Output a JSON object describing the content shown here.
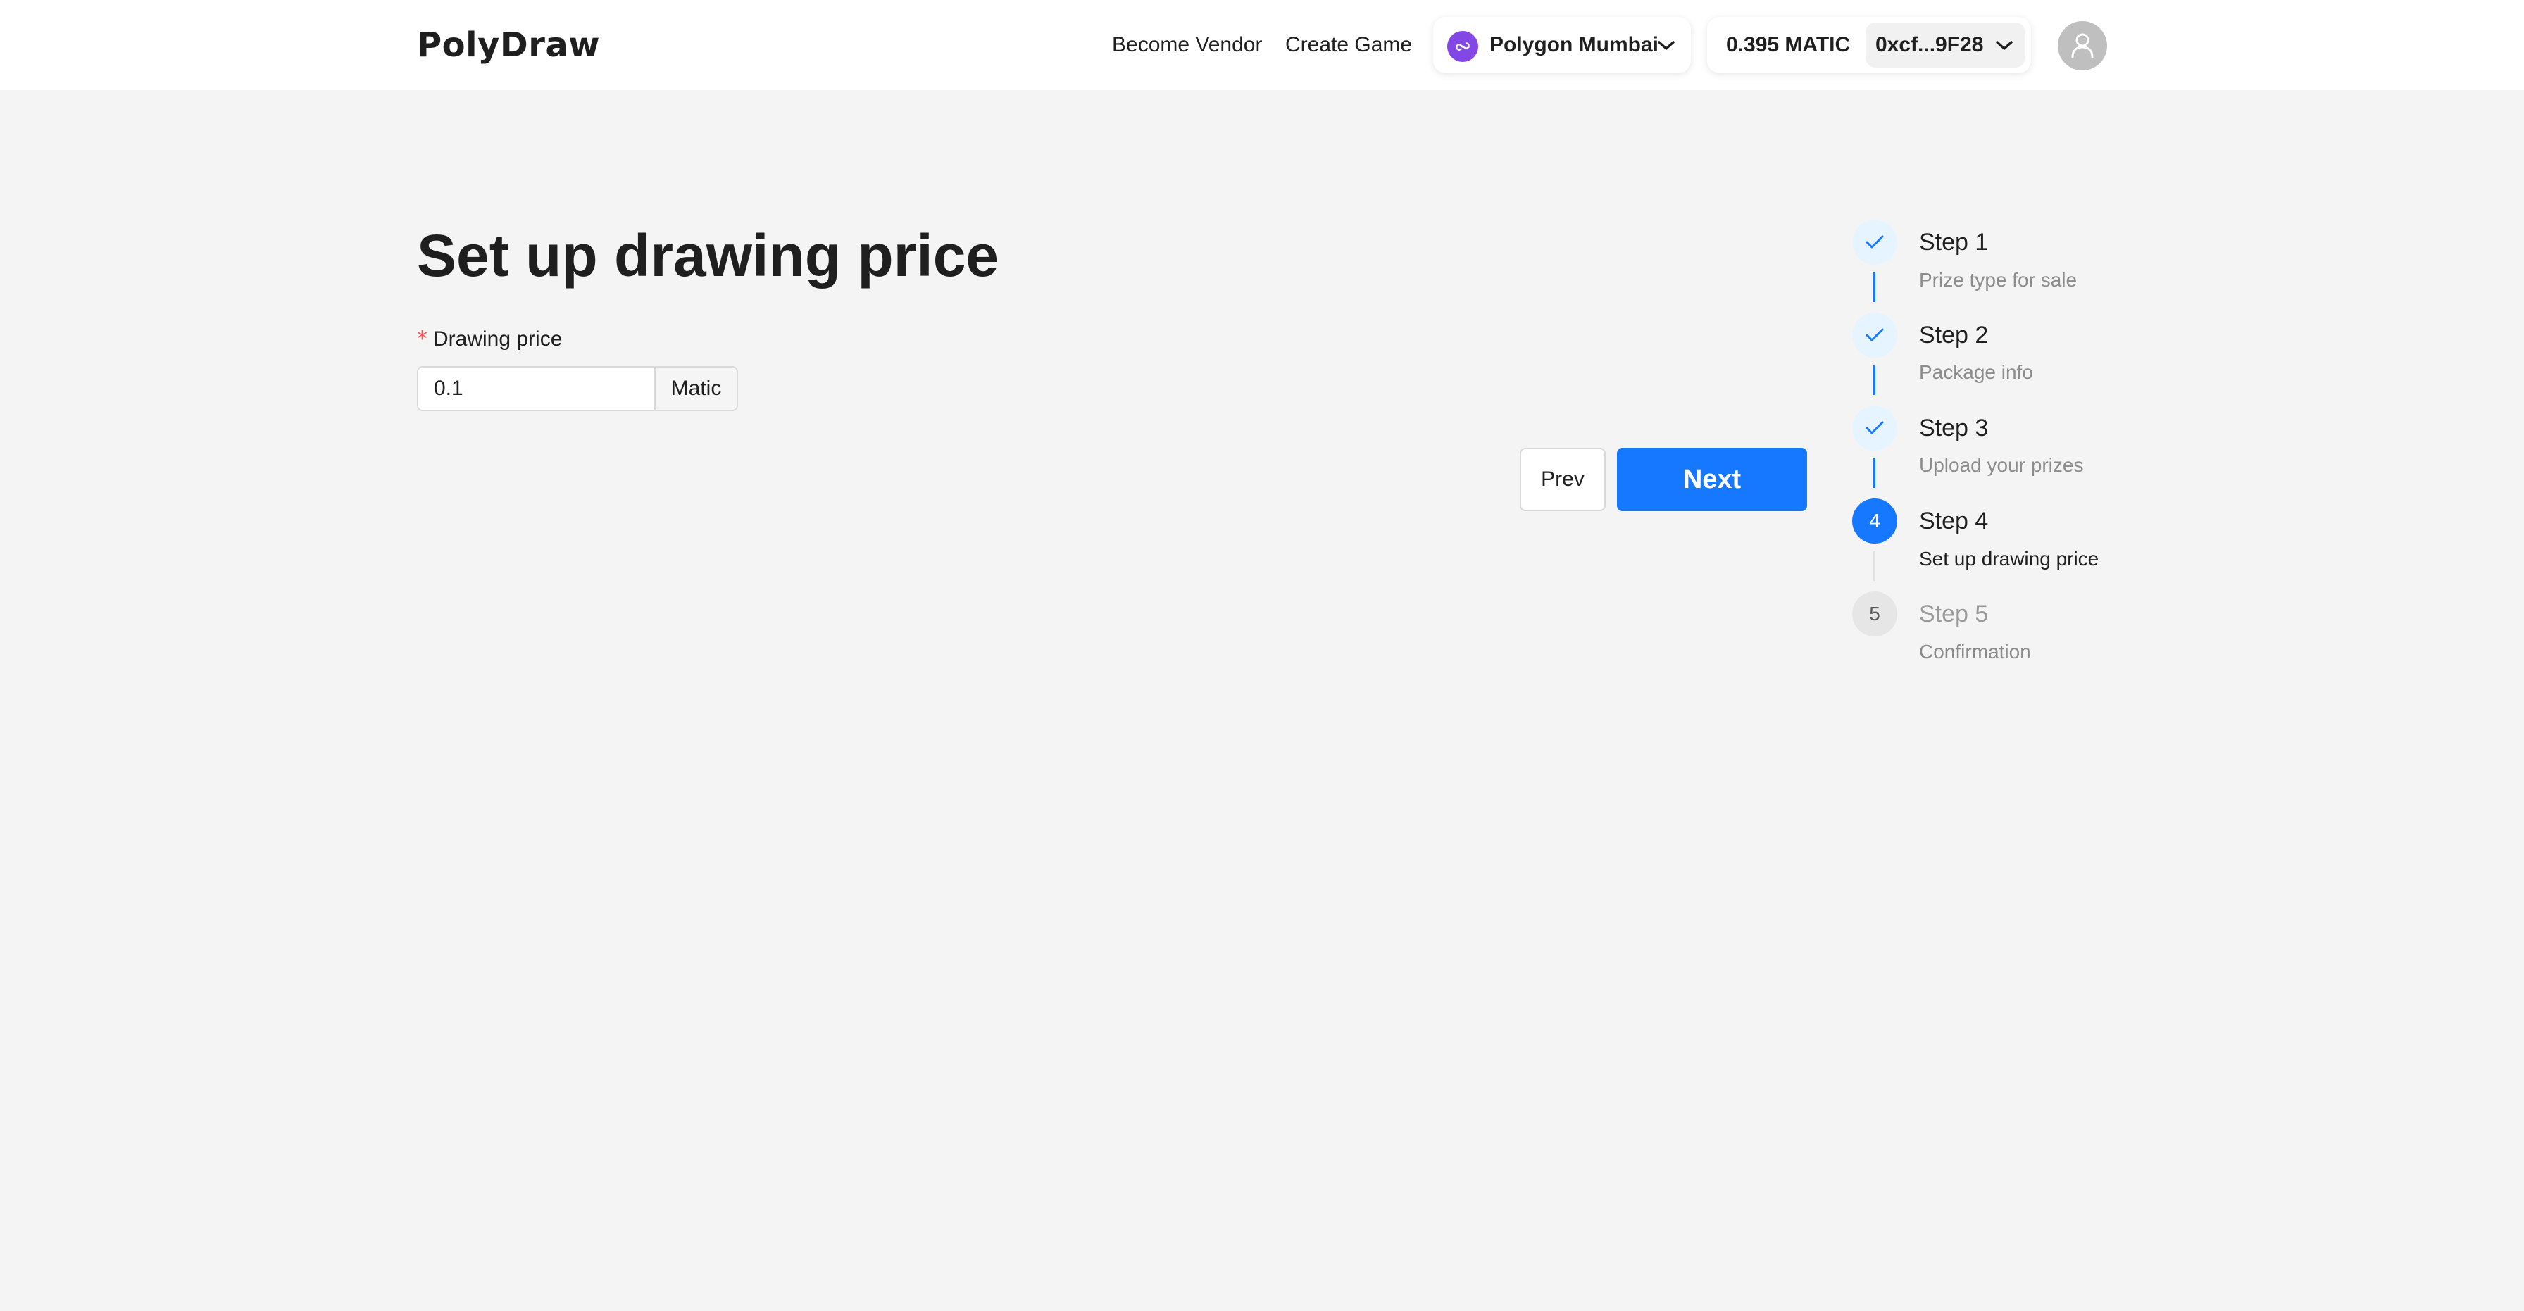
{
  "app": {
    "logo": "PolyDraw"
  },
  "nav": {
    "become_vendor": "Become Vendor",
    "create_game": "Create Game"
  },
  "network": {
    "name": "Polygon Mumbai",
    "icon": "polygon-logo-icon",
    "color": "#8247e5"
  },
  "wallet": {
    "balance": "0.395 MATIC",
    "address": "0xcf...9F28"
  },
  "page": {
    "title": "Set up drawing price"
  },
  "form": {
    "required_mark": "*",
    "price_label": "Drawing price",
    "price_value": "0.1",
    "price_unit": "Matic"
  },
  "buttons": {
    "prev": "Prev",
    "next": "Next"
  },
  "steps": [
    {
      "title": "Step 1",
      "description": "Prize type for sale",
      "status": "finished"
    },
    {
      "title": "Step 2",
      "description": "Package info",
      "status": "finished"
    },
    {
      "title": "Step 3",
      "description": "Upload your prizes",
      "status": "finished"
    },
    {
      "title": "Step 4",
      "description": "Set up drawing price",
      "status": "process",
      "number": "4"
    },
    {
      "title": "Step 5",
      "description": "Confirmation",
      "status": "wait",
      "number": "5"
    }
  ],
  "colors": {
    "primary": "#1677ff",
    "required": "#ff4d4f",
    "background": "#f4f4f4"
  }
}
